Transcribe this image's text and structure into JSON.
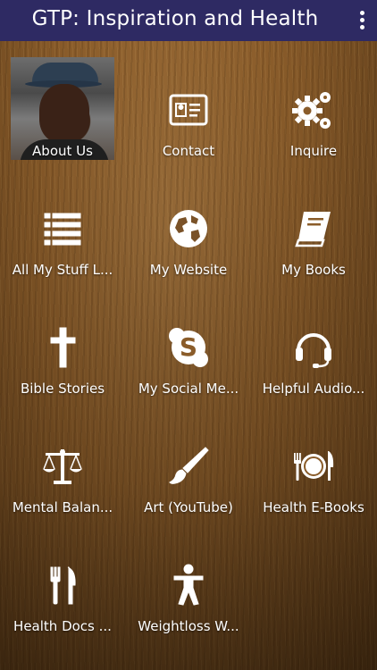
{
  "header": {
    "title": "GTP: Inspiration and Health"
  },
  "tiles": [
    {
      "label": "About Us"
    },
    {
      "label": "Contact",
      "icon": "contact-card-icon"
    },
    {
      "label": "Inquire",
      "icon": "gears-icon"
    },
    {
      "label": "All My Stuff L...",
      "icon": "list-icon"
    },
    {
      "label": "My Website",
      "icon": "globe-icon"
    },
    {
      "label": "My Books",
      "icon": "book-icon"
    },
    {
      "label": "Bible Stories",
      "icon": "cross-icon"
    },
    {
      "label": "My Social Me...",
      "icon": "skype-icon"
    },
    {
      "label": "Helpful Audio...",
      "icon": "headset-icon"
    },
    {
      "label": "Mental Balan...",
      "icon": "scales-icon"
    },
    {
      "label": "Art (YouTube)",
      "icon": "paintbrush-icon"
    },
    {
      "label": "Health E-Books",
      "icon": "plate-cutlery-icon"
    },
    {
      "label": "Health Docs ...",
      "icon": "cutlery-icon"
    },
    {
      "label": "Weightloss W...",
      "icon": "person-icon"
    }
  ]
}
